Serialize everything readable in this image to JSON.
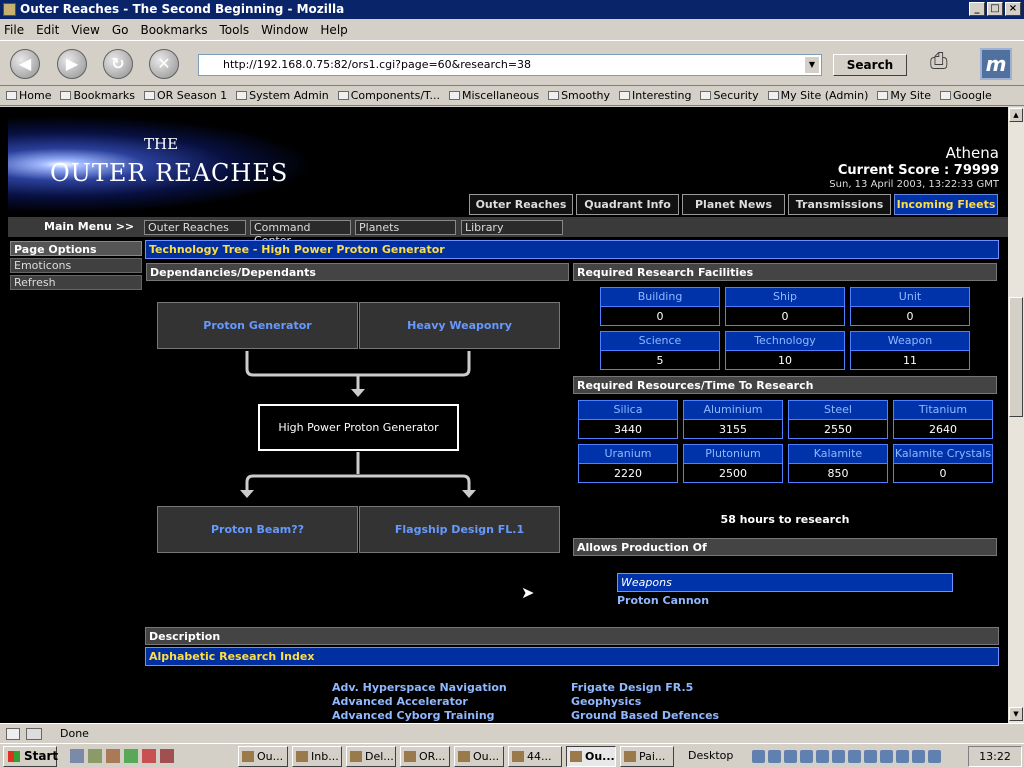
{
  "window": {
    "title": "Outer Reaches - The Second Beginning - Mozilla"
  },
  "menu": [
    "File",
    "Edit",
    "View",
    "Go",
    "Bookmarks",
    "Tools",
    "Window",
    "Help"
  ],
  "nav": {
    "url": "http://192.168.0.75:82/ors1.cgi?page=60&research=38",
    "search_label": "Search"
  },
  "bookmarks": [
    "Home",
    "Bookmarks",
    "OR Season 1",
    "System Admin",
    "Components/T...",
    "Miscellaneous",
    "Smoothy",
    "Interesting",
    "Security",
    "My Site (Admin)",
    "My Site",
    "Google"
  ],
  "header": {
    "logo_the": "THE",
    "logo_name": "OUTER REACHES",
    "player": "Athena",
    "score": "Current Score : 79999",
    "datetime": "Sun, 13 April 2003, 13:22:33 GMT"
  },
  "tabs": [
    "Outer Reaches",
    "Quadrant Info",
    "Planet News",
    "Transmissions",
    "Incoming Fleets"
  ],
  "main_menu": {
    "label": "Main Menu >>",
    "items": [
      "Outer Reaches",
      "Command Center",
      "Planets",
      "Library"
    ]
  },
  "sidebar": {
    "title": "Page Options",
    "items": [
      "Emoticons",
      "Refresh"
    ]
  },
  "tech": {
    "title": "Technology Tree - High Power Proton Generator",
    "dep_header": "Dependancies/Dependants",
    "parents": [
      "Proton Generator",
      "Heavy Weaponry"
    ],
    "current": "High Power Proton Generator",
    "children": [
      "Proton Beam??",
      "Flagship Design FL.1"
    ]
  },
  "facilities": {
    "header": "Required Research Facilities",
    "items": [
      {
        "label": "Building",
        "value": "0"
      },
      {
        "label": "Ship",
        "value": "0"
      },
      {
        "label": "Unit",
        "value": "0"
      },
      {
        "label": "Science",
        "value": "5"
      },
      {
        "label": "Technology",
        "value": "10"
      },
      {
        "label": "Weapon",
        "value": "11"
      }
    ]
  },
  "resources": {
    "header": "Required Resources/Time To Research",
    "items": [
      {
        "label": "Silica",
        "value": "3440"
      },
      {
        "label": "Aluminium",
        "value": "3155"
      },
      {
        "label": "Steel",
        "value": "2550"
      },
      {
        "label": "Titanium",
        "value": "2640"
      },
      {
        "label": "Uranium",
        "value": "2220"
      },
      {
        "label": "Plutonium",
        "value": "2500"
      },
      {
        "label": "Kalamite",
        "value": "850"
      },
      {
        "label": "Kalamite Crystals",
        "value": "0"
      }
    ],
    "time": "58 hours to research"
  },
  "production": {
    "header": "Allows Production Of",
    "category": "Weapons",
    "item": "Proton Cannon"
  },
  "description": {
    "header": "Description",
    "index_title": "Alphabetic Research Index"
  },
  "index_links": {
    "col1": [
      "Adv. Hyperspace Navigation",
      "Advanced Accelerator",
      "Advanced Cyborg Training"
    ],
    "col2": [
      "Frigate Design FR.5",
      "Geophysics",
      "Ground Based Defences"
    ]
  },
  "status": {
    "text": "Done"
  },
  "taskbar": {
    "start": "Start",
    "buttons": [
      "Ou...",
      "Inb...",
      "Del...",
      "OR...",
      "Ou...",
      "44...",
      "Ou...",
      "Pai..."
    ],
    "desktop": "Desktop",
    "clock": "13:22"
  }
}
